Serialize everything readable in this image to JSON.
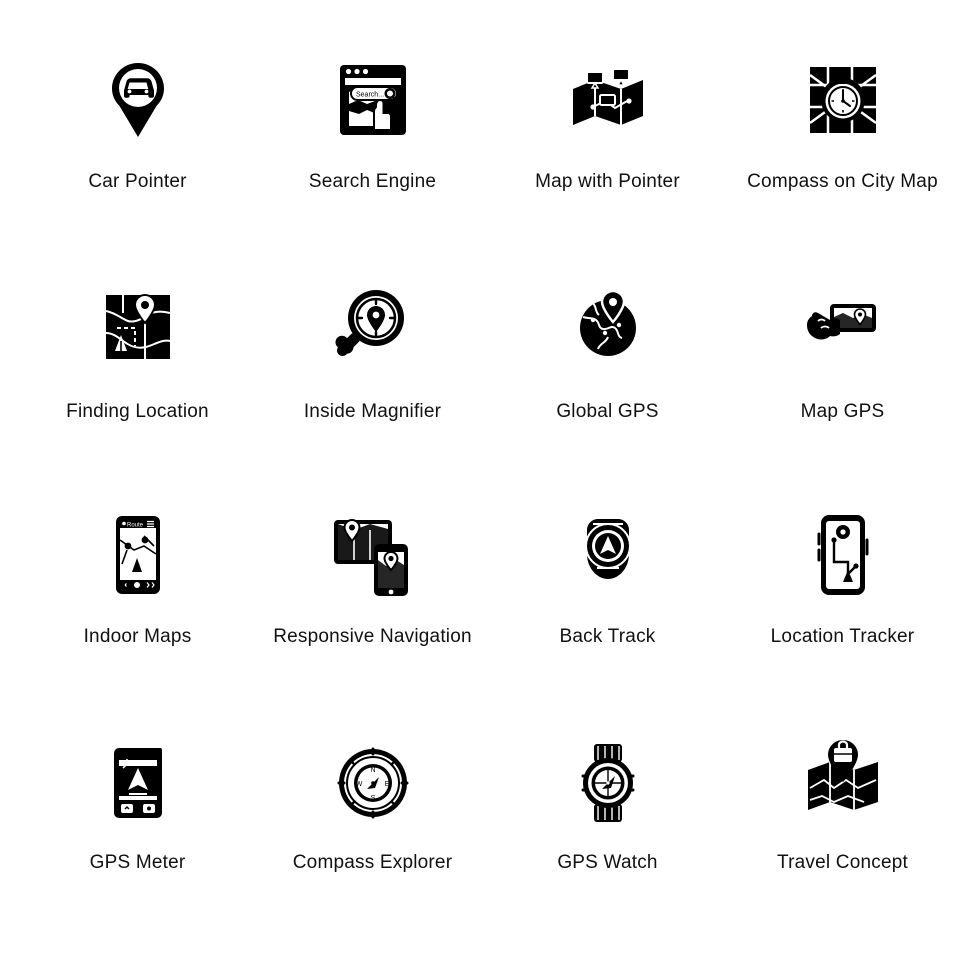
{
  "page": {
    "background_color": "#ffffff",
    "icon_color": "#000000",
    "caption_color": "#111111",
    "columns": 4,
    "rows": 4
  },
  "icons": [
    {
      "id": "car-pointer",
      "label": "Car Pointer",
      "glyph": "map-pin-car-icon"
    },
    {
      "id": "search-engine",
      "label": "Search Engine",
      "glyph": "browser-search-map-icon"
    },
    {
      "id": "map-with-pointer",
      "label": "Map with Pointer",
      "glyph": "folded-map-pins-icon"
    },
    {
      "id": "compass-on-city-map",
      "label": "Compass on City Map",
      "glyph": "compass-over-map-icon"
    },
    {
      "id": "finding-location",
      "label": "Finding Location",
      "glyph": "map-location-pin-icon"
    },
    {
      "id": "inside-magnifier",
      "label": "Inside Magnifier",
      "glyph": "magnifier-compass-pin-icon"
    },
    {
      "id": "global-gps",
      "label": "Global GPS",
      "glyph": "globe-pin-icon"
    },
    {
      "id": "map-gps",
      "label": "Map GPS",
      "glyph": "hand-phone-map-icon"
    },
    {
      "id": "indoor-maps",
      "label": "Indoor Maps",
      "glyph": "phone-route-icon"
    },
    {
      "id": "responsive-navigation",
      "label": "Responsive Navigation",
      "glyph": "tablet-phone-map-icon"
    },
    {
      "id": "back-track",
      "label": "Back Track",
      "glyph": "gps-device-arrow-icon"
    },
    {
      "id": "location-tracker",
      "label": "Location Tracker",
      "glyph": "phone-track-path-icon"
    },
    {
      "id": "gps-meter",
      "label": "GPS Meter",
      "glyph": "gps-meter-device-icon"
    },
    {
      "id": "compass-explorer",
      "label": "Compass Explorer",
      "glyph": "compass-dial-icon"
    },
    {
      "id": "gps-watch",
      "label": "GPS Watch",
      "glyph": "wristwatch-compass-icon"
    },
    {
      "id": "travel-concept",
      "label": "Travel Concept",
      "glyph": "map-bag-pin-icon"
    }
  ],
  "search_engine_detail": {
    "search_placeholder": "Search..."
  },
  "indoor_maps_detail": {
    "header_label": "Route"
  },
  "compass_explorer_detail": {
    "cardinals": [
      "N",
      "E",
      "S",
      "W"
    ]
  }
}
